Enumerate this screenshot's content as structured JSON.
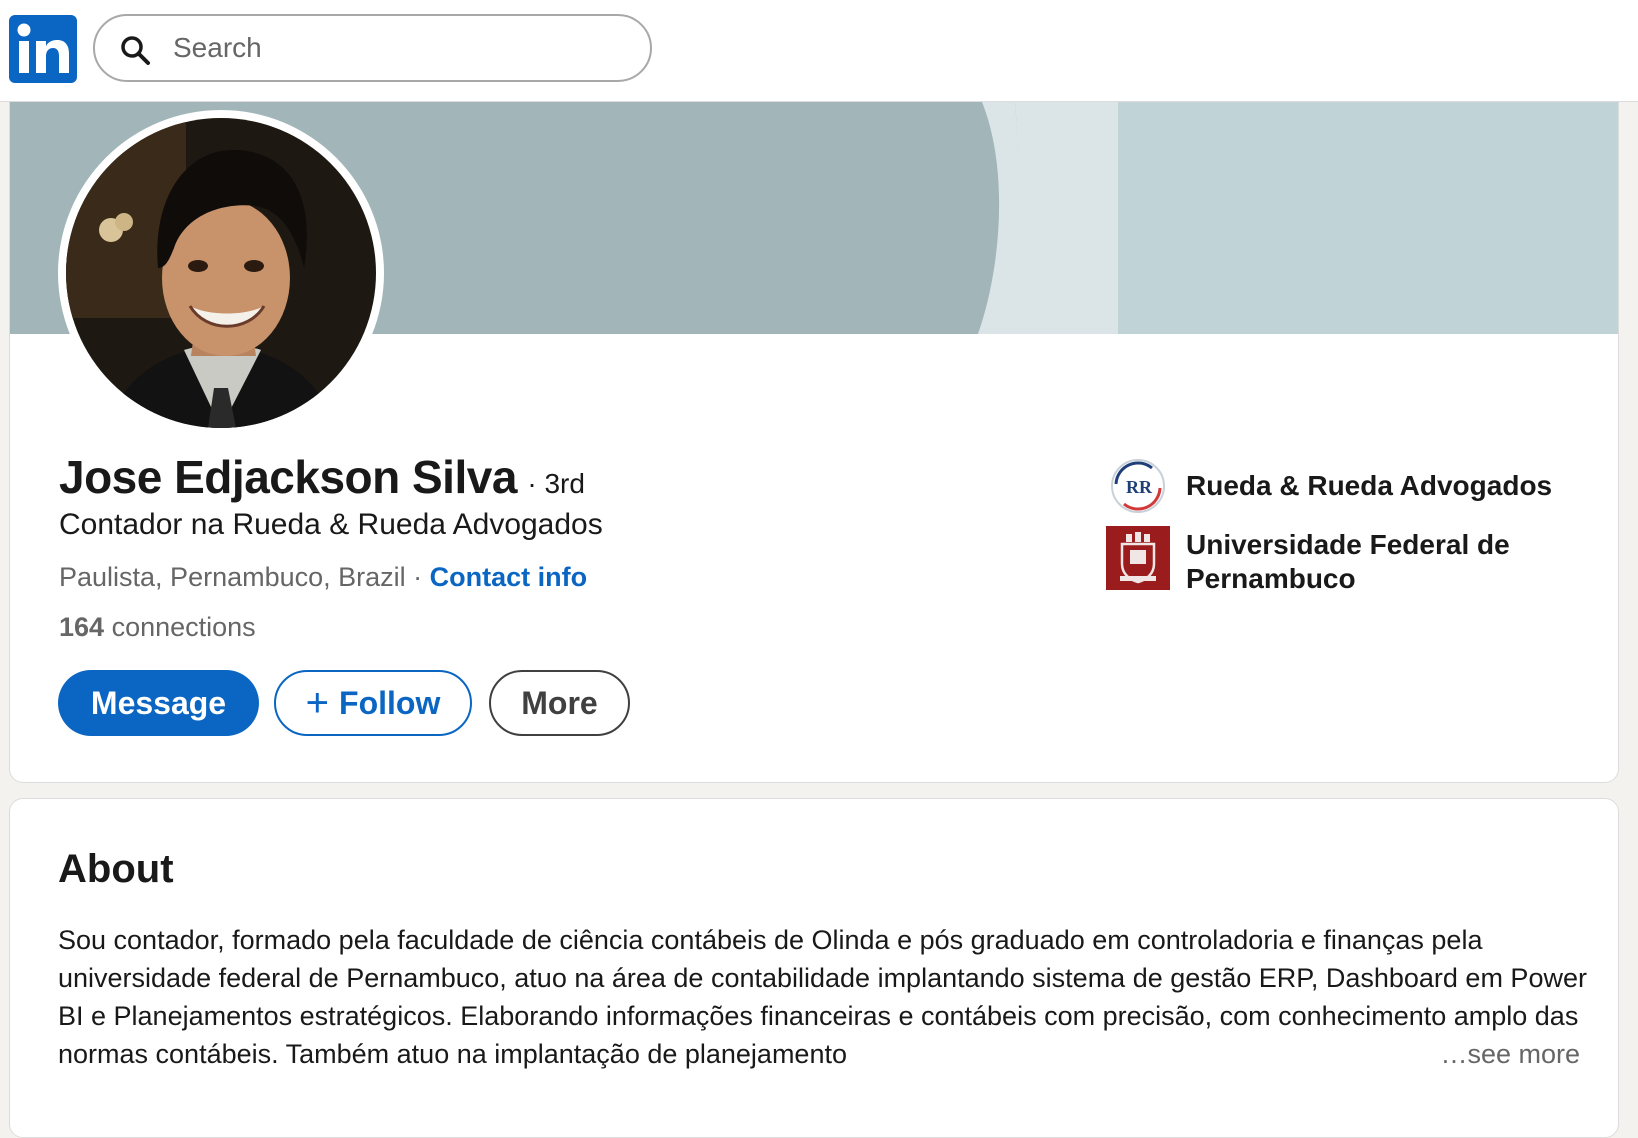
{
  "nav": {
    "search_placeholder": "Search"
  },
  "profile": {
    "name": "Jose Edjackson Silva",
    "degree": "· 3rd",
    "headline": "Contador na Rueda & Rueda Advogados",
    "location": "Paulista, Pernambuco, Brazil",
    "separator": " · ",
    "contact_info_label": "Contact info",
    "connections_count": "164",
    "connections_label": " connections",
    "buttons": {
      "message": "Message",
      "follow": "Follow",
      "more": "More"
    },
    "organizations": [
      {
        "name": "Rueda & Rueda Advogados",
        "logo_text": "RR"
      },
      {
        "name": "Universidade Federal de Pernambuco"
      }
    ]
  },
  "about": {
    "title": "About",
    "text": "Sou contador, formado pela faculdade de ciência contábeis de Olinda e pós graduado em controladoria e finanças pela universidade federal de Pernambuco, atuo na área de contabilidade implantando sistema de gestão ERP, Dashboard em Power BI e Planejamentos estratégicos. Elaborando informações financeiras e contábeis com precisão, com conhecimento amplo das normas contábeis. Também atuo na implantação de planejamento",
    "see_more": "…see more"
  },
  "colors": {
    "brand": "#0a66c2",
    "banner_main": "#a2b6ba",
    "banner_light": "#dbe5e7",
    "banner_right": "#c0d4d8",
    "ufpe_red": "#9b1c1c"
  }
}
